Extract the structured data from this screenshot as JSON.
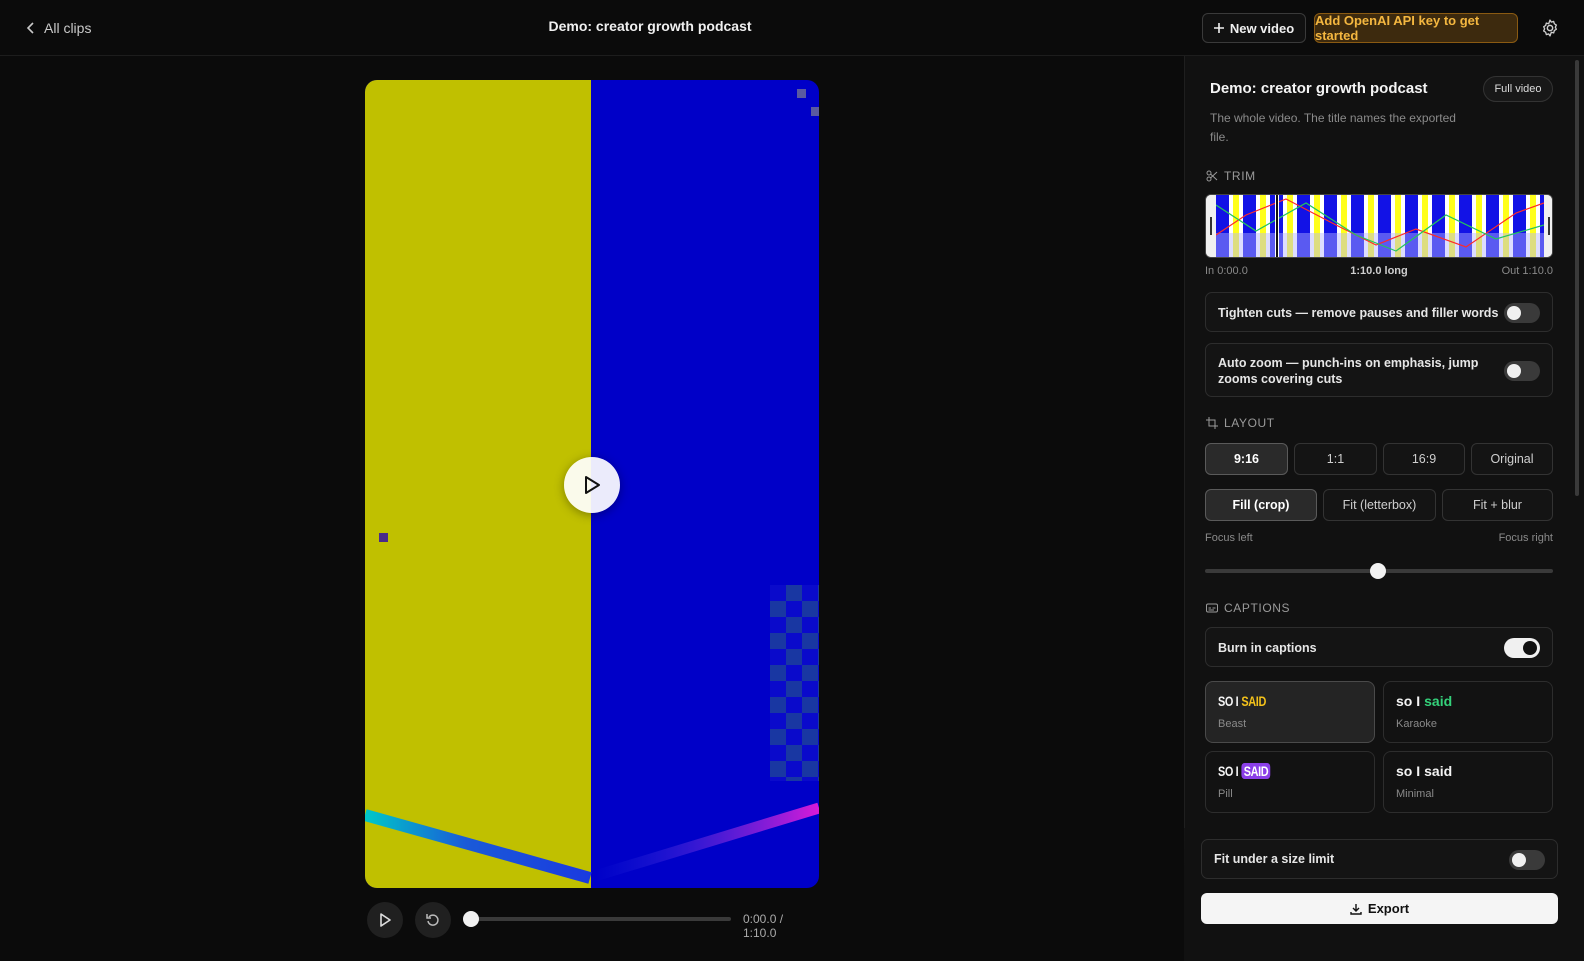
{
  "topbar": {
    "back_label": "All clips",
    "title": "Demo: creator growth podcast",
    "new_video_label": "New video",
    "api_key_label": "Add OpenAI API key to get started",
    "accent": "#f4b740"
  },
  "player": {
    "timecode": "0:00.0 / 1:10.0",
    "progress": 0
  },
  "panel": {
    "title": "Demo: creator growth podcast",
    "scope_badge": "Full video",
    "description": "The whole video. The title names the exported file.",
    "trim": {
      "label": "TRIM",
      "in_label": "In 0:00.0",
      "length_label": "1:10.0 long",
      "out_label": "Out 1:10.0"
    },
    "options": {
      "tighten_cuts": {
        "label": "Tighten cuts — remove pauses and filler words",
        "on": false
      },
      "auto_zoom": {
        "label": "Auto zoom — punch-ins on emphasis, jump zooms covering cuts",
        "on": false
      }
    },
    "layout": {
      "label": "LAYOUT",
      "ratios": [
        "9:16",
        "1:1",
        "16:9",
        "Original"
      ],
      "active_ratio": "9:16",
      "fits": [
        "Fill (crop)",
        "Fit (letterbox)",
        "Fit + blur"
      ],
      "active_fit": "Fill (crop)",
      "focus_left_label": "Focus left",
      "focus_right_label": "Focus right",
      "focus_value": 0.5
    },
    "captions": {
      "label": "CAPTIONS",
      "burn_in_label": "Burn in captions",
      "burn_in_on": true,
      "styles": [
        {
          "name": "Beast",
          "sample_a": "SO I",
          "sample_b": "SAID",
          "active": true
        },
        {
          "name": "Karaoke",
          "sample_a": "so I",
          "sample_b": "said",
          "active": false
        },
        {
          "name": "Pill",
          "sample_a": "SO I",
          "sample_b": "SAID",
          "active": false
        },
        {
          "name": "Minimal",
          "sample_a": "so I",
          "sample_b": "said",
          "active": false
        }
      ]
    },
    "export": {
      "size_limit_label": "Fit under a size limit",
      "size_limit_on": false,
      "export_label": "Export"
    }
  }
}
